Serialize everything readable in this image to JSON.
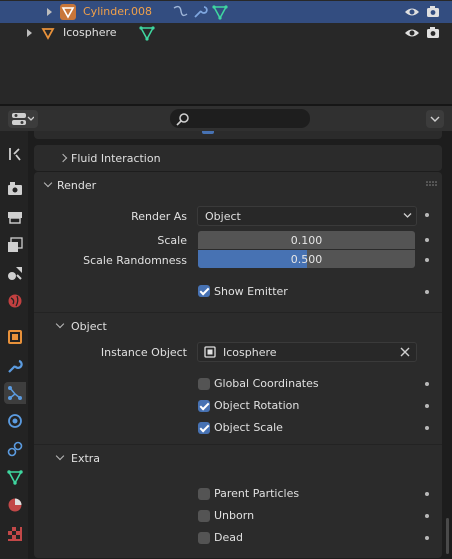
{
  "outliner": {
    "rows": [
      {
        "name": "Cylinder.008",
        "selected": true
      },
      {
        "name": "Icosphere",
        "selected": false
      }
    ]
  },
  "properties": {
    "search_placeholder": "",
    "sections": {
      "fluid_interaction": "Fluid Interaction",
      "render": "Render",
      "object": "Object",
      "extra": "Extra"
    },
    "render": {
      "render_as_label": "Render As",
      "render_as_value": "Object",
      "scale_label": "Scale",
      "scale_value": "0.100",
      "scale_randomness_label": "Scale Randomness",
      "scale_randomness_value": "0.500",
      "scale_randomness_fraction": 0.5,
      "show_emitter_label": "Show Emitter",
      "show_emitter_checked": true
    },
    "object": {
      "instance_object_label": "Instance Object",
      "instance_object_value": "Icosphere",
      "global_coordinates_label": "Global Coordinates",
      "global_coordinates_checked": false,
      "object_rotation_label": "Object Rotation",
      "object_rotation_checked": true,
      "object_scale_label": "Object Scale",
      "object_scale_checked": true
    },
    "extra": {
      "parent_particles_label": "Parent Particles",
      "parent_particles_checked": false,
      "unborn_label": "Unborn",
      "unborn_checked": false,
      "dead_label": "Dead",
      "dead_checked": false
    }
  },
  "colors": {
    "selection": "#334d80",
    "accent": "#4772b3",
    "object_orange": "#e8913a",
    "mesh_green": "#3fd7a0"
  },
  "tabs": [
    "tool-icon",
    "render-icon",
    "output-icon",
    "view-layer-icon",
    "scene-icon",
    "world-icon",
    "object-icon",
    "modifier-icon",
    "particles-icon",
    "physics-icon",
    "constraints-icon",
    "data-icon",
    "material-icon",
    "texture-icon"
  ]
}
